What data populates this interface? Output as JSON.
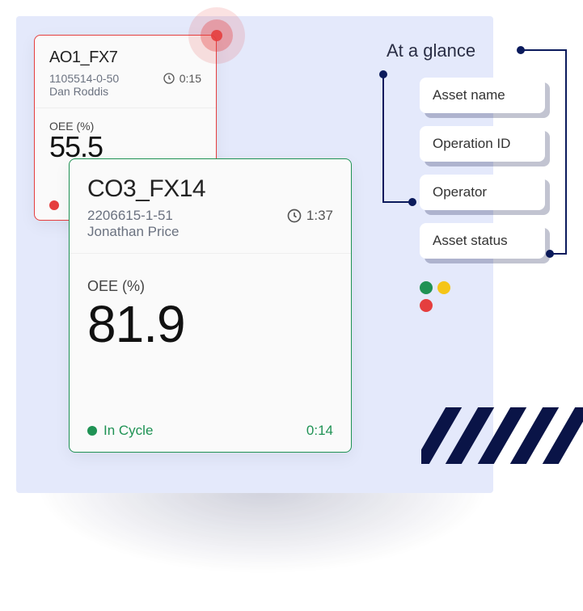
{
  "glance": {
    "title": "At a glance",
    "tags": [
      "Asset name",
      "Operation ID",
      "Operator",
      "Asset status"
    ]
  },
  "card_a": {
    "asset_name": "AO1_FX7",
    "operation_id": "1105514-0-50",
    "operator": "Dan Roddis",
    "elapsed": "0:15",
    "oee_label": "OEE (%)",
    "oee_value": "55.5"
  },
  "card_b": {
    "asset_name": "CO3_FX14",
    "operation_id": "2206615-1-51",
    "operator": "Jonathan Price",
    "elapsed": "1:37",
    "oee_label": "OEE (%)",
    "oee_value": "81.9",
    "status_text": "In Cycle",
    "status_time": "0:14"
  }
}
